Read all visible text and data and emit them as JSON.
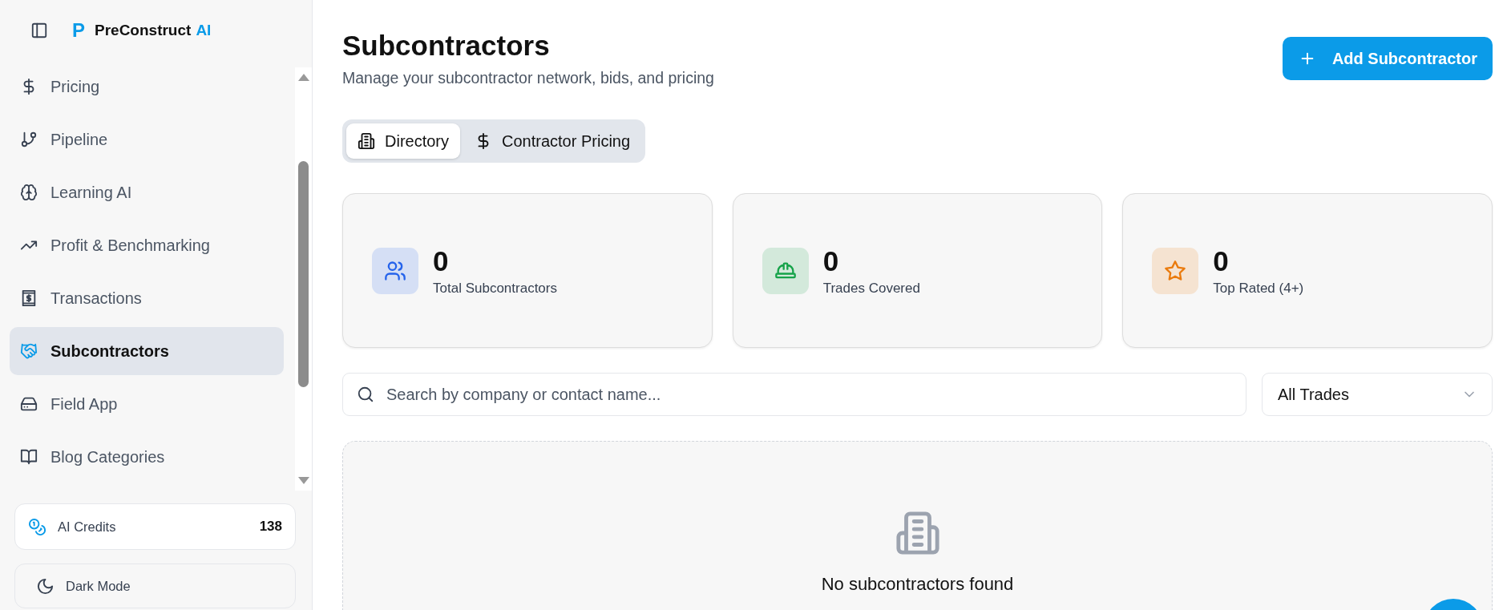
{
  "sidebar": {
    "brand": {
      "mark": "P",
      "name": "PreConstruct",
      "suffix": "AI"
    },
    "items": [
      {
        "label": "Pricing",
        "selected": false
      },
      {
        "label": "Pipeline",
        "selected": false
      },
      {
        "label": "Learning AI",
        "selected": false
      },
      {
        "label": "Profit & Benchmarking",
        "selected": false
      },
      {
        "label": "Transactions",
        "selected": false
      },
      {
        "label": "Subcontractors",
        "selected": true
      },
      {
        "label": "Field App",
        "selected": false
      },
      {
        "label": "Blog Categories",
        "selected": false
      }
    ],
    "credits": {
      "label": "AI Credits",
      "value": "138"
    },
    "dark_mode": {
      "label": "Dark Mode"
    }
  },
  "header": {
    "title": "Subcontractors",
    "subtitle": "Manage your subcontractor network, bids, and pricing",
    "add_button": "Add Subcontractor"
  },
  "tabs": [
    {
      "label": "Directory",
      "selected": true
    },
    {
      "label": "Contractor Pricing",
      "selected": false
    }
  ],
  "stats": [
    {
      "value": "0",
      "label": "Total Subcontractors",
      "color": "#2563eb"
    },
    {
      "value": "0",
      "label": "Trades Covered",
      "color": "#16a34a"
    },
    {
      "value": "0",
      "label": "Top Rated (4+)",
      "color": "#ea7a0c"
    }
  ],
  "search": {
    "placeholder": "Search by company or contact name..."
  },
  "trade_filter": {
    "value": "All Trades"
  },
  "empty_state": {
    "message": "No subcontractors found"
  }
}
